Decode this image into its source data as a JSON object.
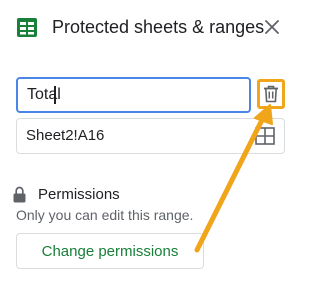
{
  "header": {
    "title": "Protected sheets & ranges",
    "app_icon": "sheets-icon",
    "close_icon": "close-icon"
  },
  "range_editor": {
    "name_value": "Total",
    "range_value": "Sheet2!A16",
    "delete_icon": "trash-icon",
    "select_range_icon": "grid-icon"
  },
  "permissions": {
    "title": "Permissions",
    "description": "Only you can edit this range.",
    "button_label": "Change permissions"
  },
  "annotation": {
    "arrow_color": "#f0a51b",
    "highlight_color": "#f0a51b"
  },
  "colors": {
    "brand_green": "#188038",
    "focus_blue": "#4a86e8"
  }
}
